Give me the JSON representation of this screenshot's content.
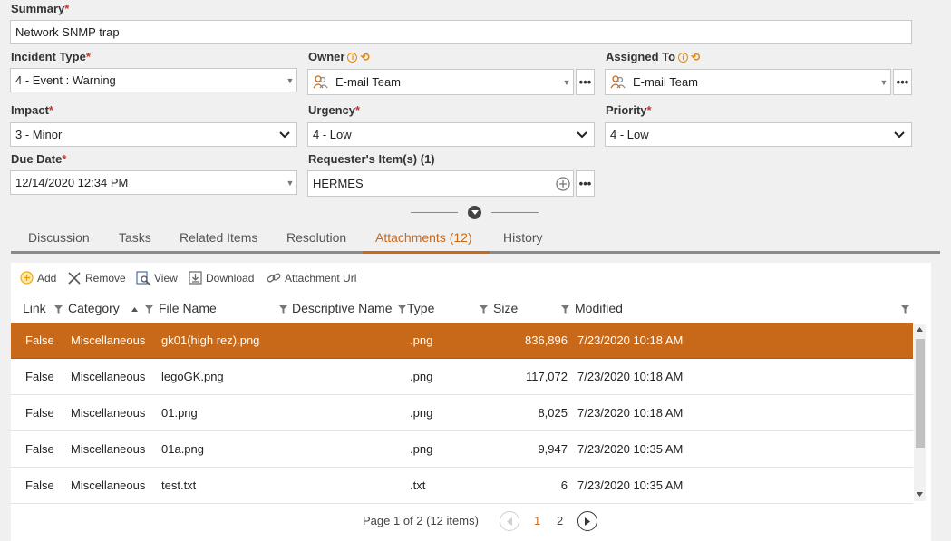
{
  "form": {
    "summary": {
      "label": "Summary",
      "value": "Network SNMP trap"
    },
    "incident_type": {
      "label": "Incident Type",
      "value": "4 - Event : Warning"
    },
    "owner": {
      "label": "Owner",
      "value": "E-mail Team"
    },
    "assigned_to": {
      "label": "Assigned To",
      "value": "E-mail Team"
    },
    "impact": {
      "label": "Impact",
      "value": "3 - Minor"
    },
    "urgency": {
      "label": "Urgency",
      "value": "4 - Low"
    },
    "priority": {
      "label": "Priority",
      "value": "4 - Low"
    },
    "due_date": {
      "label": "Due Date",
      "value": "12/14/2020 12:34 PM"
    },
    "requesters_items": {
      "label": "Requester's Item(s) (1)",
      "value": "HERMES"
    },
    "required_mark": "*",
    "more_button": "•••"
  },
  "tabs": [
    "Discussion",
    "Tasks",
    "Related Items",
    "Resolution",
    "Attachments (12)",
    "History"
  ],
  "active_tab": "Attachments (12)",
  "toolbar": {
    "add": "Add",
    "remove": "Remove",
    "view": "View",
    "download": "Download",
    "attachment_url": "Attachment Url"
  },
  "table": {
    "columns": [
      "Link",
      "Category",
      "File Name",
      "Descriptive Name",
      "Type",
      "Size",
      "Modified"
    ],
    "rows": [
      {
        "link": "False",
        "category": "Miscellaneous",
        "file_name": "gk01(high rez).png",
        "descriptive_name": "",
        "type": ".png",
        "size": "836,896",
        "modified": "7/23/2020 10:18 AM"
      },
      {
        "link": "False",
        "category": "Miscellaneous",
        "file_name": "legoGK.png",
        "descriptive_name": "",
        "type": ".png",
        "size": "117,072",
        "modified": "7/23/2020 10:18 AM"
      },
      {
        "link": "False",
        "category": "Miscellaneous",
        "file_name": "01.png",
        "descriptive_name": "",
        "type": ".png",
        "size": "8,025",
        "modified": "7/23/2020 10:18 AM"
      },
      {
        "link": "False",
        "category": "Miscellaneous",
        "file_name": "01a.png",
        "descriptive_name": "",
        "type": ".png",
        "size": "9,947",
        "modified": "7/23/2020 10:35 AM"
      },
      {
        "link": "False",
        "category": "Miscellaneous",
        "file_name": "test.txt",
        "descriptive_name": "",
        "type": ".txt",
        "size": "6",
        "modified": "7/23/2020 10:35 AM"
      }
    ]
  },
  "pager": {
    "summary": "Page 1 of 2 (12 items)",
    "pages": [
      "1",
      "2"
    ],
    "current": "1"
  },
  "colors": {
    "accent": "#c8691a",
    "info": "#e08a10",
    "required": "#c0392b"
  },
  "icons": [
    "info-icon",
    "reset-icon",
    "team-icon",
    "chevron-down-icon",
    "add-icon",
    "remove-icon",
    "view-icon",
    "download-icon",
    "link-icon",
    "filter-icon",
    "sort-asc-icon",
    "collapse-icon",
    "prev-page-icon",
    "next-page-icon"
  ]
}
